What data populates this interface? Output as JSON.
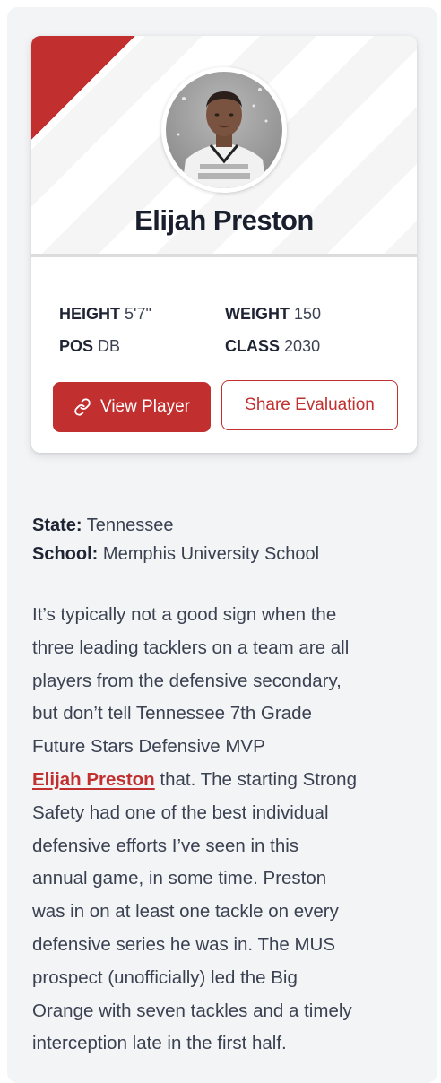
{
  "player": {
    "name": "Elijah Preston",
    "avatar_alt": "player-photo"
  },
  "stats": {
    "height_label": "HEIGHT",
    "height_value": "5'7\"",
    "weight_label": "WEIGHT",
    "weight_value": "150",
    "pos_label": "POS",
    "pos_value": "DB",
    "class_label": "CLASS",
    "class_value": "2030"
  },
  "buttons": {
    "view_player": "View Player",
    "share_evaluation": "Share Evaluation"
  },
  "info": {
    "state_label": "State:",
    "state_value": "Tennessee",
    "school_label": "School:",
    "school_value": "Memphis University School"
  },
  "article": {
    "line1": "It’s typically not a good sign when the",
    "line2": "three leading tacklers on a team are all",
    "line3": "players from the defensive secondary,",
    "line4": "but don’t tell Tennessee 7th Grade",
    "line5": "Future Stars Defensive MVP",
    "link_text": "Elijah Preston",
    "line6_rest": " that. The starting Strong",
    "line7": "Safety had one of the best individual",
    "line8": "defensive efforts I’ve seen in this",
    "line9": "annual game, in some time. Preston",
    "line10": "was in on at least one tackle on every",
    "line11": "defensive series he was in. The MUS",
    "line12": "prospect (unofficially) led the Big",
    "line13": "Orange with seven tackles and a timely",
    "line14": "interception late in the first half."
  },
  "colors": {
    "accent": "#c22f2f",
    "text": "#3a4150",
    "panel": "#f3f4f6"
  }
}
